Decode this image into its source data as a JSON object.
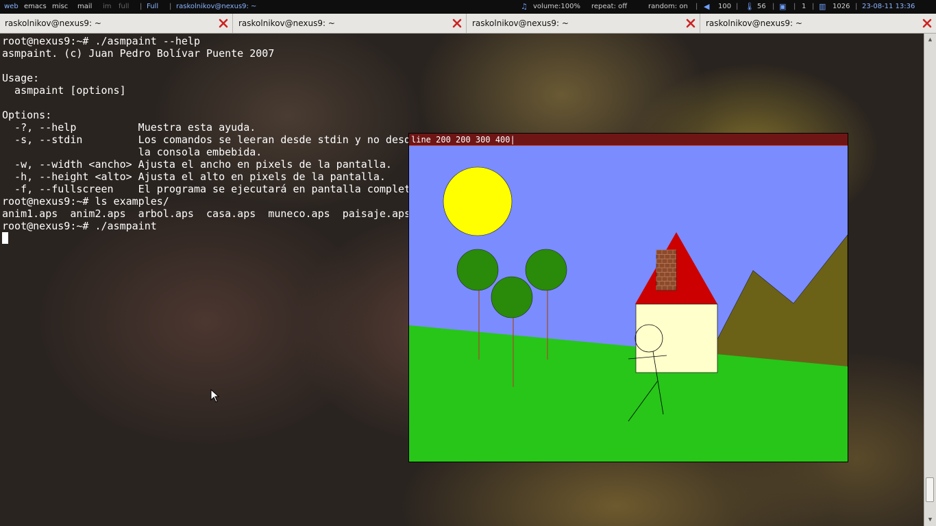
{
  "topbar": {
    "tags": [
      "web",
      "emacs",
      "misc",
      "mail",
      "im",
      "full"
    ],
    "layout": "Full",
    "window_title": "raskolnikov@nexus9: ~",
    "volume": "volume:100%",
    "repeat": "repeat: off",
    "random": "random: on",
    "battery": "100",
    "temperature": "56",
    "cpu": "1",
    "memory": "1026",
    "clock": "23-08-11 13:36"
  },
  "tabs": [
    {
      "label": "raskolnikov@nexus9: ~"
    },
    {
      "label": "raskolnikov@nexus9: ~"
    },
    {
      "label": "raskolnikov@nexus9: ~"
    },
    {
      "label": "raskolnikov@nexus9: ~"
    }
  ],
  "terminal": {
    "lines": [
      "root@nexus9:~# ./asmpaint --help",
      "asmpaint. (c) Juan Pedro Bolívar Puente 2007",
      "",
      "Usage:",
      "  asmpaint [options]",
      "",
      "Options:",
      "  -?, --help          Muestra esta ayuda.",
      "  -s, --stdin         Los comandos se leeran desde stdin y no desde",
      "                      la consola embebida.",
      "  -w, --width <ancho> Ajusta el ancho en pixels de la pantalla.",
      "  -h, --height <alto> Ajusta el alto en pixels de la pantalla.",
      "  -f, --fullscreen    El programa se ejecutará en pantalla completa.",
      "root@nexus9:~# ls examples/",
      "anim1.aps  anim2.aps  arbol.aps  casa.aps  muneco.aps  paisaje.aps",
      "root@nexus9:~# ./asmpaint"
    ]
  },
  "paint": {
    "command": "line 200 200 300 400|",
    "colors": {
      "sky": "#7b8cfe",
      "grass": "#27c619",
      "sun": "#ffff00",
      "tree_top": "#2a8a0a",
      "trunk": "#a0502c",
      "roof": "#cc0000",
      "house": "#ffffcc",
      "chimney": "#8b4a2b",
      "mountain": "#6b6218",
      "cmdbar": "#6e1616"
    }
  },
  "colors": {
    "topbar_bg": "#0e0e0e",
    "tabbar_bg": "#e8e6e2",
    "close_icon": "#cc2222"
  }
}
